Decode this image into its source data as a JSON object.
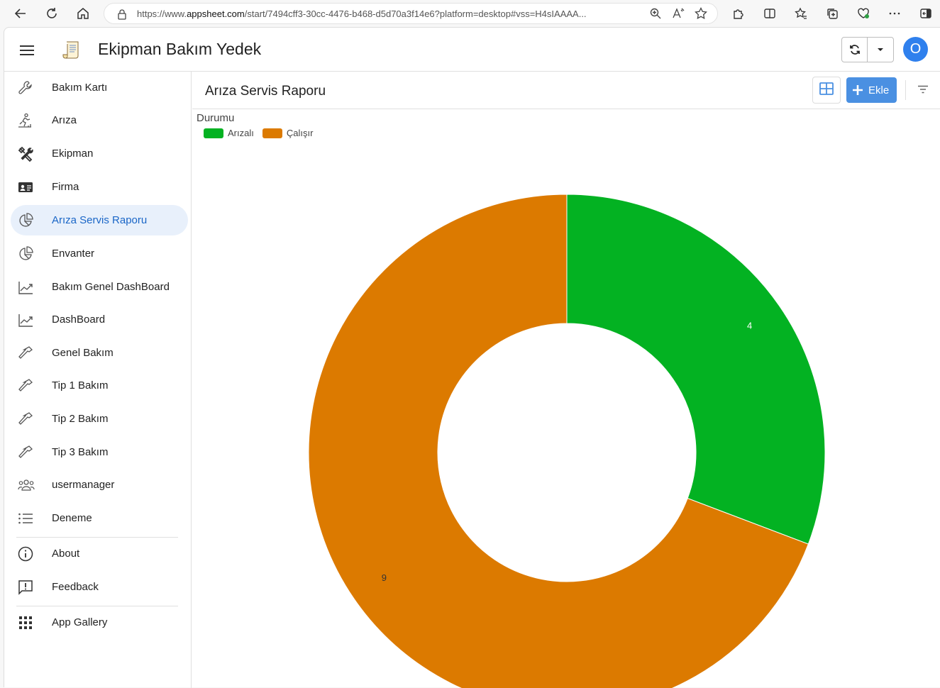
{
  "browser": {
    "url_prefix": "https://www.",
    "url_host": "appsheet.com",
    "url_rest": "/start/7494cff3-30cc-4476-b468-d5d70a3f14e6?platform=desktop#vss=H4sIAAAA..."
  },
  "app": {
    "title": "Ekipman Bakım Yedek",
    "avatar_letter": "O",
    "accent_color": "#4a90e2"
  },
  "sidebar": {
    "items": [
      {
        "label": "Bakım Kartı",
        "icon": "wrench-icon"
      },
      {
        "label": "Arıza",
        "icon": "person-slipping-icon"
      },
      {
        "label": "Ekipman",
        "icon": "tools-icon"
      },
      {
        "label": "Firma",
        "icon": "id-card-icon"
      },
      {
        "label": "Arıza Servis Raporu",
        "icon": "pie-chart-icon",
        "active": true
      },
      {
        "label": "Envanter",
        "icon": "pie-chart-icon"
      },
      {
        "label": "Bakım Genel DashBoard",
        "icon": "line-chart-icon"
      },
      {
        "label": "DashBoard",
        "icon": "line-chart-icon"
      },
      {
        "label": "Genel Bakım",
        "icon": "hammer-icon"
      },
      {
        "label": "Tip 1 Bakım",
        "icon": "hammer-icon"
      },
      {
        "label": "Tip 2 Bakım",
        "icon": "hammer-icon"
      },
      {
        "label": "Tip 3 Bakım",
        "icon": "hammer-icon"
      },
      {
        "label": "usermanager",
        "icon": "users-icon"
      },
      {
        "label": "Deneme",
        "icon": "list-icon"
      }
    ],
    "footer_items": [
      {
        "label": "About",
        "icon": "info-icon"
      },
      {
        "label": "Feedback",
        "icon": "feedback-icon"
      }
    ],
    "gallery": {
      "label": "App Gallery",
      "icon": "grid-icon"
    }
  },
  "view": {
    "title": "Arıza Servis Raporu",
    "add_label": "Ekle"
  },
  "chart_data": {
    "type": "pie",
    "donut": true,
    "legend_title": "Durumu",
    "legend_position": "top-left",
    "categories": [
      "Arızalı",
      "Çalışır"
    ],
    "values": [
      4,
      9
    ],
    "colors": [
      "#03b222",
      "#dc7a00"
    ]
  }
}
